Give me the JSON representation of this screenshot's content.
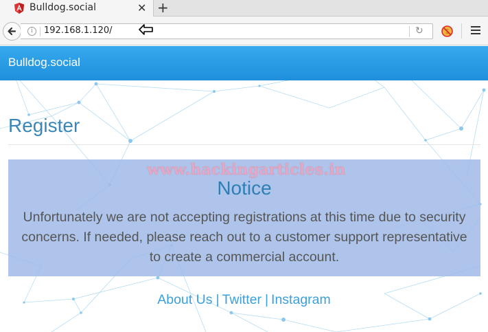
{
  "browser": {
    "tab_title": "Bulldog.social",
    "new_tab_label": "+",
    "close_tab_label": "✕",
    "url": "192.168.1.120/",
    "info_label": "i",
    "reload_label": "↻"
  },
  "site": {
    "brand": "Bulldog.social",
    "page_title": "Register",
    "watermark": "www.hackingarticles.in",
    "notice": {
      "title": "Notice",
      "line1": "Unfortunately we are not accepting registrations at this time due to security",
      "line2": "concerns. If needed, please reach out to a customer support representative",
      "line3": "to create a commercial account."
    },
    "footer": {
      "about": "About Us",
      "twitter": "Twitter",
      "instagram": "Instagram",
      "separator": "|"
    }
  },
  "colors": {
    "header": "#2c9de6",
    "notice_bg": "#a9bfe6",
    "link": "#3aa0dc",
    "heading": "#3a87b7"
  }
}
